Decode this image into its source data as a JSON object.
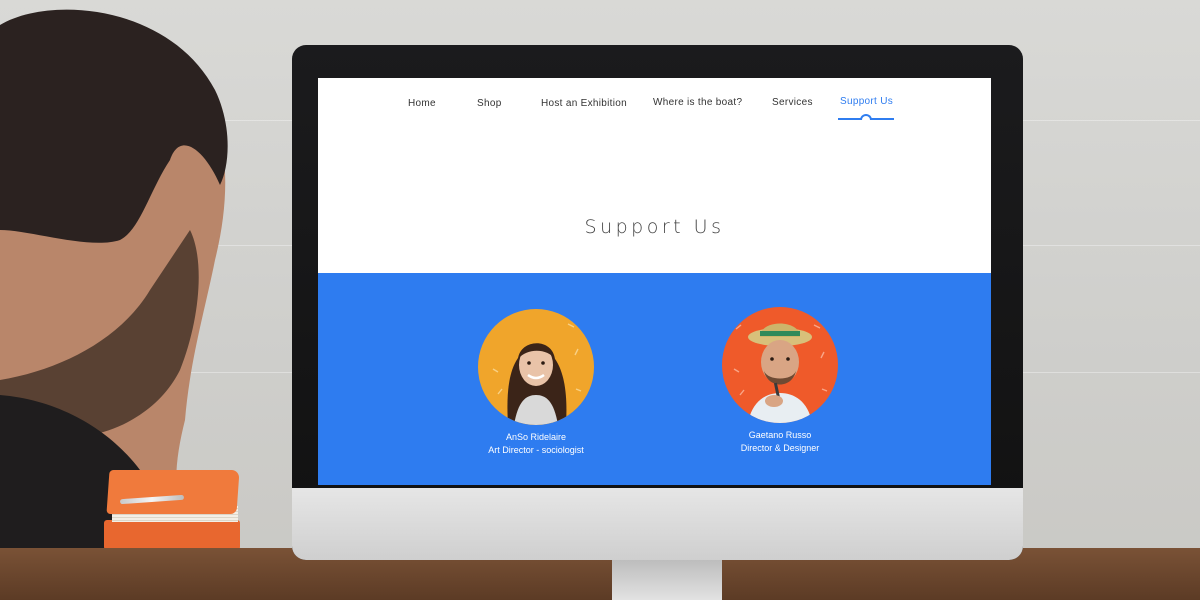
{
  "nav": {
    "items": [
      {
        "label": "Home"
      },
      {
        "label": "Shop"
      },
      {
        "label": "Host an Exhibition"
      },
      {
        "label": "Where is the boat?"
      },
      {
        "label": "Services"
      },
      {
        "label": "Support Us",
        "active": true
      }
    ]
  },
  "page": {
    "title": "Support Us"
  },
  "team": [
    {
      "name": "AnSo Ridelaire",
      "role": "Art Director - sociologist",
      "avatar_bg": "#f0a52b"
    },
    {
      "name": "Gaetano Russo",
      "role": "Director & Designer",
      "avatar_bg": "#ef5a2a"
    }
  ],
  "colors": {
    "accent": "#2f7df0",
    "band": "#2e7cf0"
  }
}
